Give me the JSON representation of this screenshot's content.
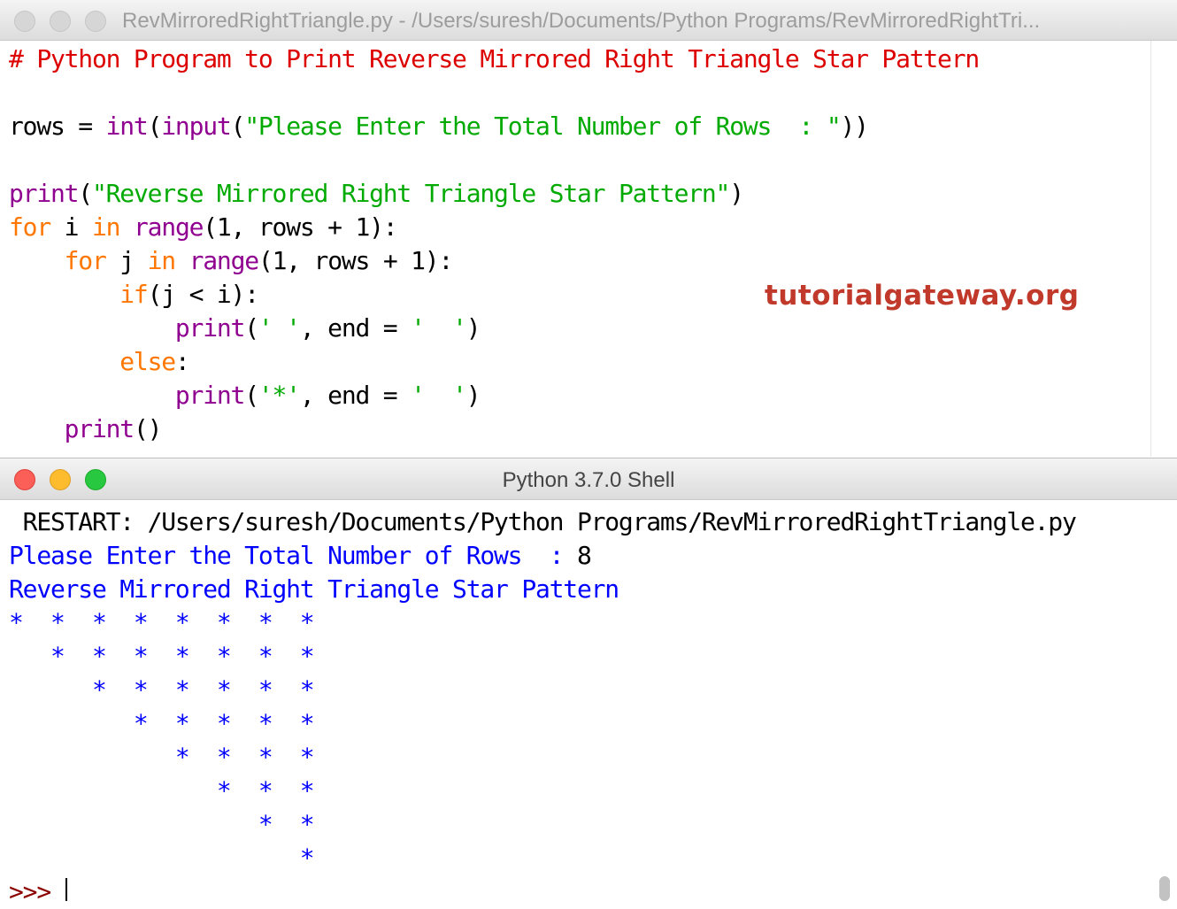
{
  "editor": {
    "title": "RevMirroredRightTriangle.py - /Users/suresh/Documents/Python Programs/RevMirroredRightTri...",
    "lines": {
      "l1": "# Python Program to Print Reverse Mirrored Right Triangle Star Pattern",
      "l3_var": "rows = ",
      "l3_int": "int",
      "l3_p1": "(",
      "l3_input": "input",
      "l3_p2": "(",
      "l3_str": "\"Please Enter the Total Number of Rows  : \"",
      "l3_end": "))",
      "l5_print": "print",
      "l5_p1": "(",
      "l5_str": "\"Reverse Mirrored Right Triangle Star Pattern\"",
      "l5_end": ")",
      "l6_for": "for",
      "l6_i": " i ",
      "l6_in": "in",
      "l6_sp": " ",
      "l6_range": "range",
      "l6_rest": "(1, rows + 1):",
      "l7_indent": "    ",
      "l7_for": "for",
      "l7_j": " j ",
      "l7_in": "in",
      "l7_sp": " ",
      "l7_range": "range",
      "l7_rest": "(1, rows + 1):",
      "l8_indent": "        ",
      "l8_if": "if",
      "l8_rest": "(j < i):",
      "l9_indent": "            ",
      "l9_print": "print",
      "l9_p1": "(",
      "l9_str1": "' '",
      "l9_mid": ", end = ",
      "l9_str2": "'  '",
      "l9_end": ")",
      "l10_indent": "        ",
      "l10_else": "else",
      "l10_colon": ":",
      "l11_indent": "            ",
      "l11_print": "print",
      "l11_p1": "(",
      "l11_str1": "'*'",
      "l11_mid": ", end = ",
      "l11_str2": "'  '",
      "l11_end": ")",
      "l12_indent": "    ",
      "l12_print": "print",
      "l12_end": "()"
    }
  },
  "watermark": "tutorialgateway.org",
  "shell": {
    "title": "Python 3.7.0 Shell",
    "restart": " RESTART: /Users/suresh/Documents/Python Programs/RevMirroredRightTriangle.py",
    "prompt_line": "Please Enter the Total Number of Rows  : ",
    "input_value": "8",
    "pattern_title": "Reverse Mirrored Right Triangle Star Pattern",
    "star_rows": [
      "*  *  *  *  *  *  *  *",
      "   *  *  *  *  *  *  *",
      "      *  *  *  *  *  *",
      "         *  *  *  *  *",
      "            *  *  *  *",
      "               *  *  *",
      "                  *  *",
      "                     *"
    ],
    "prompt": ">>> "
  },
  "colors": {
    "comment": "#dd0000",
    "keyword": "#ff7700",
    "builtin": "#900090",
    "string": "#00aa00",
    "output": "#0000ff",
    "prompt": "#8b0000",
    "watermark": "#c0392b"
  }
}
